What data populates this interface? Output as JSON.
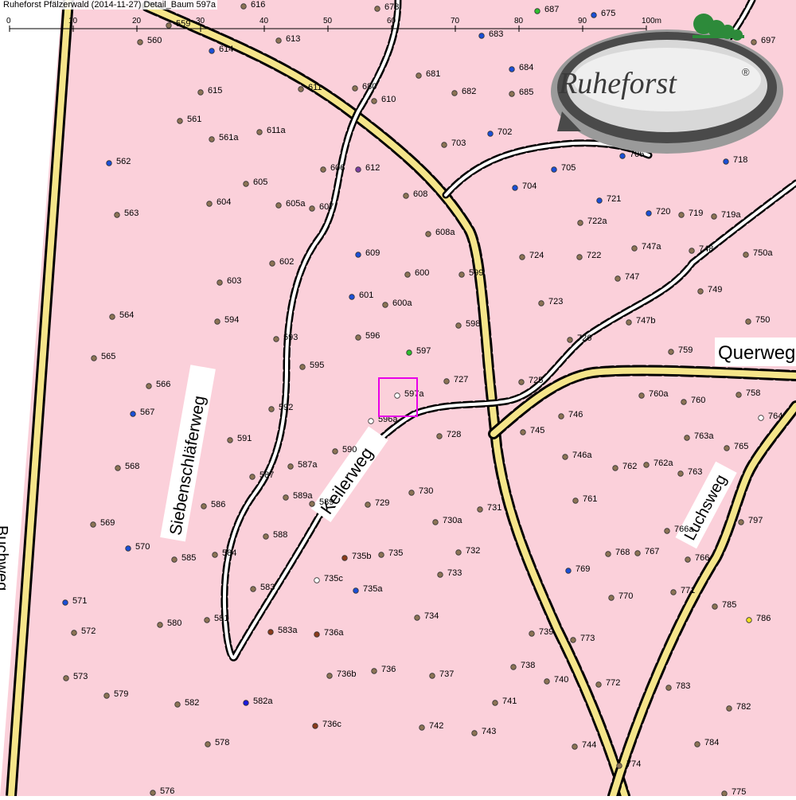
{
  "title": "Ruheforst Pfälzerwald (2014-11-27) Detail_Baum 597a",
  "logo": {
    "text": "Ruheforst",
    "mark": "®"
  },
  "colors": {
    "background": "#fbd0da",
    "road_fill": "#f5e58a",
    "road_edge": "#000000",
    "path_fill": "#ffffff",
    "path_dash": "#000000",
    "highlight": "#e800e8",
    "logo_dark": "#3a3a3a",
    "logo_green": "#2d8a3a"
  },
  "scale_bar": {
    "ticks": [
      "0",
      "10",
      "20",
      "30",
      "40",
      "50",
      "60",
      "70",
      "80",
      "90",
      "100m"
    ]
  },
  "street_names": [
    "Querweg",
    "Keilerweg",
    "Siebenschläferweg",
    "Luchsweg",
    "Buchweg"
  ],
  "tree_color_key": {
    "b": "#8b7355",
    "u": "#1a4fd6",
    "g": "#2fbf2f",
    "p": "#7b3fa0",
    "r": "#8b3a1a",
    "w": "#ffffff",
    "y": "#f0e020",
    "n": "#1a1ae0"
  },
  "trees": [
    {
      "id": "616",
      "c": "b"
    },
    {
      "id": "678",
      "c": "b"
    },
    {
      "id": "687",
      "c": "g"
    },
    {
      "id": "675",
      "c": "u"
    },
    {
      "id": "559",
      "c": "b"
    },
    {
      "id": "560",
      "c": "b"
    },
    {
      "id": "614",
      "c": "u"
    },
    {
      "id": "613",
      "c": "b"
    },
    {
      "id": "683",
      "c": "u"
    },
    {
      "id": "697",
      "c": "b"
    },
    {
      "id": "681",
      "c": "b"
    },
    {
      "id": "684",
      "c": "u"
    },
    {
      "id": "680",
      "c": "b"
    },
    {
      "id": "611",
      "c": "b"
    },
    {
      "id": "615",
      "c": "b"
    },
    {
      "id": "610",
      "c": "b"
    },
    {
      "id": "682",
      "c": "b"
    },
    {
      "id": "685",
      "c": "b"
    },
    {
      "id": "561",
      "c": "b"
    },
    {
      "id": "611a",
      "c": "b"
    },
    {
      "id": "561a",
      "c": "b"
    },
    {
      "id": "703",
      "c": "b"
    },
    {
      "id": "702",
      "c": "u"
    },
    {
      "id": "562",
      "c": "u"
    },
    {
      "id": "606",
      "c": "b"
    },
    {
      "id": "612",
      "c": "p"
    },
    {
      "id": "705",
      "c": "u"
    },
    {
      "id": "706",
      "c": "u"
    },
    {
      "id": "718",
      "c": "u"
    },
    {
      "id": "605",
      "c": "b"
    },
    {
      "id": "704",
      "c": "u"
    },
    {
      "id": "608",
      "c": "b"
    },
    {
      "id": "721",
      "c": "u"
    },
    {
      "id": "604",
      "c": "b"
    },
    {
      "id": "605a",
      "c": "b"
    },
    {
      "id": "607",
      "c": "b"
    },
    {
      "id": "563",
      "c": "b"
    },
    {
      "id": "720",
      "c": "u"
    },
    {
      "id": "719",
      "c": "b"
    },
    {
      "id": "719a",
      "c": "b"
    },
    {
      "id": "722a",
      "c": "b"
    },
    {
      "id": "608a",
      "c": "b"
    },
    {
      "id": "747a",
      "c": "b"
    },
    {
      "id": "748",
      "c": "b"
    },
    {
      "id": "609",
      "c": "u"
    },
    {
      "id": "724",
      "c": "b"
    },
    {
      "id": "722",
      "c": "b"
    },
    {
      "id": "750a",
      "c": "b"
    },
    {
      "id": "602",
      "c": "b"
    },
    {
      "id": "600",
      "c": "b"
    },
    {
      "id": "599",
      "c": "b"
    },
    {
      "id": "747",
      "c": "b"
    },
    {
      "id": "603",
      "c": "b"
    },
    {
      "id": "749",
      "c": "b"
    },
    {
      "id": "601",
      "c": "u"
    },
    {
      "id": "600a",
      "c": "b"
    },
    {
      "id": "723",
      "c": "b"
    },
    {
      "id": "564",
      "c": "b"
    },
    {
      "id": "594",
      "c": "b"
    },
    {
      "id": "747b",
      "c": "b"
    },
    {
      "id": "750",
      "c": "b"
    },
    {
      "id": "598",
      "c": "b"
    },
    {
      "id": "593",
      "c": "b"
    },
    {
      "id": "596",
      "c": "b"
    },
    {
      "id": "726",
      "c": "b"
    },
    {
      "id": "759",
      "c": "b"
    },
    {
      "id": "565",
      "c": "b"
    },
    {
      "id": "597",
      "c": "g"
    },
    {
      "id": "595",
      "c": "b"
    },
    {
      "id": "727",
      "c": "b"
    },
    {
      "id": "725",
      "c": "b"
    },
    {
      "id": "566",
      "c": "b"
    },
    {
      "id": "597a",
      "c": "w"
    },
    {
      "id": "760a",
      "c": "b"
    },
    {
      "id": "760",
      "c": "b"
    },
    {
      "id": "758",
      "c": "b"
    },
    {
      "id": "764",
      "c": "w"
    },
    {
      "id": "567",
      "c": "u"
    },
    {
      "id": "592",
      "c": "b"
    },
    {
      "id": "596a",
      "c": "w"
    },
    {
      "id": "746",
      "c": "b"
    },
    {
      "id": "728",
      "c": "b"
    },
    {
      "id": "745",
      "c": "b"
    },
    {
      "id": "763a",
      "c": "b"
    },
    {
      "id": "591",
      "c": "b"
    },
    {
      "id": "765",
      "c": "b"
    },
    {
      "id": "590",
      "c": "b"
    },
    {
      "id": "746a",
      "c": "b"
    },
    {
      "id": "568",
      "c": "b"
    },
    {
      "id": "587a",
      "c": "b"
    },
    {
      "id": "762",
      "c": "b"
    },
    {
      "id": "762a",
      "c": "b"
    },
    {
      "id": "763",
      "c": "b"
    },
    {
      "id": "587",
      "c": "b"
    },
    {
      "id": "730",
      "c": "b"
    },
    {
      "id": "589a",
      "c": "b"
    },
    {
      "id": "589",
      "c": "b"
    },
    {
      "id": "761",
      "c": "b"
    },
    {
      "id": "586",
      "c": "b"
    },
    {
      "id": "729",
      "c": "b"
    },
    {
      "id": "731",
      "c": "b"
    },
    {
      "id": "569",
      "c": "b"
    },
    {
      "id": "730a",
      "c": "b"
    },
    {
      "id": "797",
      "c": "b"
    },
    {
      "id": "766a",
      "c": "b"
    },
    {
      "id": "588",
      "c": "b"
    },
    {
      "id": "570",
      "c": "u"
    },
    {
      "id": "584",
      "c": "b"
    },
    {
      "id": "585",
      "c": "b"
    },
    {
      "id": "735b",
      "c": "r"
    },
    {
      "id": "735",
      "c": "b"
    },
    {
      "id": "732",
      "c": "b"
    },
    {
      "id": "768",
      "c": "b"
    },
    {
      "id": "767",
      "c": "b"
    },
    {
      "id": "766",
      "c": "b"
    },
    {
      "id": "769",
      "c": "u"
    },
    {
      "id": "733",
      "c": "b"
    },
    {
      "id": "735c",
      "c": "w"
    },
    {
      "id": "583",
      "c": "b"
    },
    {
      "id": "735a",
      "c": "u"
    },
    {
      "id": "771",
      "c": "b"
    },
    {
      "id": "770",
      "c": "b"
    },
    {
      "id": "571",
      "c": "u"
    },
    {
      "id": "785",
      "c": "b"
    },
    {
      "id": "581",
      "c": "b"
    },
    {
      "id": "734",
      "c": "b"
    },
    {
      "id": "786",
      "c": "y"
    },
    {
      "id": "580",
      "c": "b"
    },
    {
      "id": "583a",
      "c": "r"
    },
    {
      "id": "736a",
      "c": "r"
    },
    {
      "id": "739",
      "c": "b"
    },
    {
      "id": "773",
      "c": "b"
    },
    {
      "id": "572",
      "c": "b"
    },
    {
      "id": "738",
      "c": "b"
    },
    {
      "id": "736b",
      "c": "b"
    },
    {
      "id": "736",
      "c": "b"
    },
    {
      "id": "737",
      "c": "b"
    },
    {
      "id": "740",
      "c": "b"
    },
    {
      "id": "772",
      "c": "b"
    },
    {
      "id": "573",
      "c": "b"
    },
    {
      "id": "783",
      "c": "b"
    },
    {
      "id": "579",
      "c": "b"
    },
    {
      "id": "741",
      "c": "b"
    },
    {
      "id": "582",
      "c": "b"
    },
    {
      "id": "582a",
      "c": "n"
    },
    {
      "id": "782",
      "c": "b"
    },
    {
      "id": "736c",
      "c": "r"
    },
    {
      "id": "742",
      "c": "b"
    },
    {
      "id": "743",
      "c": "b"
    },
    {
      "id": "578",
      "c": "b"
    },
    {
      "id": "784",
      "c": "b"
    },
    {
      "id": "744",
      "c": "b"
    },
    {
      "id": "774",
      "c": "b"
    },
    {
      "id": "576",
      "c": "b"
    },
    {
      "id": "775",
      "c": "b"
    }
  ]
}
